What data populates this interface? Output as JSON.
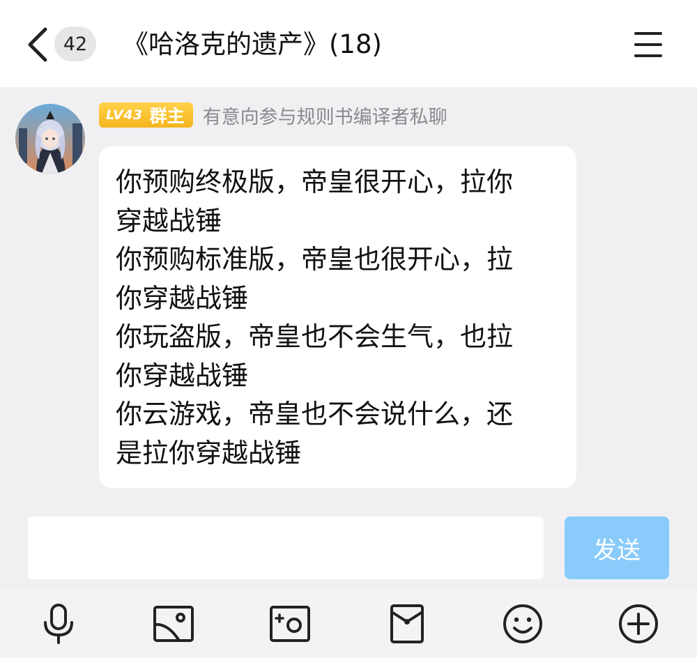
{
  "header": {
    "unread_count": "42",
    "title": "《哈洛克的遗产》(18)"
  },
  "message": {
    "level_badge": "LV43",
    "role_badge": "群主",
    "sender_name": "有意向参与规则书编译者私聊",
    "lines": [
      "你预购终极版，帝皇很开心，拉你",
      "穿越战锤",
      "你预购标准版，帝皇也很开心，拉",
      "你穿越战锤",
      "你玩盗版，帝皇也不会生气，也拉",
      "你穿越战锤",
      "你云游戏，帝皇也不会说什么，还",
      "是拉你穿越战锤"
    ]
  },
  "input": {
    "value": "",
    "placeholder": "",
    "send_label": "发送"
  },
  "toolbar": {
    "icons": [
      "microphone-icon",
      "image-icon",
      "camera-icon",
      "red-packet-icon",
      "emoji-icon",
      "plus-icon"
    ]
  },
  "colors": {
    "accent_send": "#89cbfb",
    "badge_gold": "#f5b51e",
    "background": "#f0f0f2"
  }
}
